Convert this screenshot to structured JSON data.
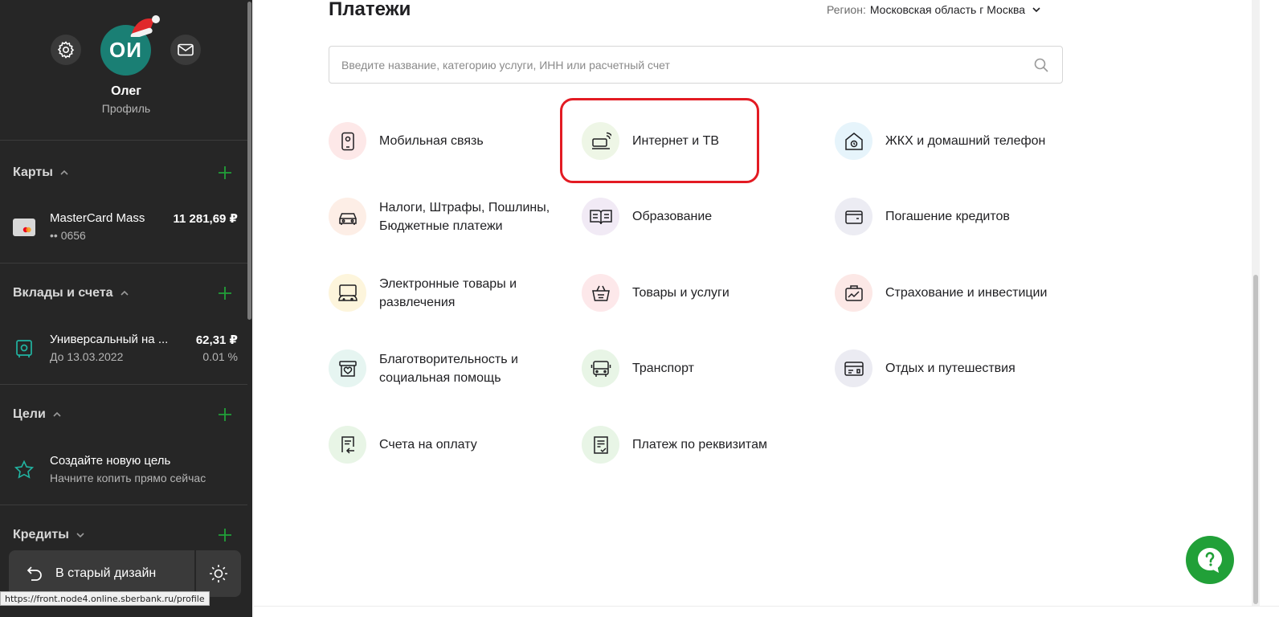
{
  "profile": {
    "initials": "ОИ",
    "name": "Олег",
    "subtitle": "Профиль"
  },
  "sidebar": {
    "cards": {
      "title": "Карты",
      "items": [
        {
          "name": "MasterCard Mass",
          "sub": "•• 0656",
          "amount": "11 281,69 ₽"
        }
      ]
    },
    "deposits": {
      "title": "Вклады и счета",
      "items": [
        {
          "name": "Универсальный на ...",
          "sub": "До 13.03.2022",
          "amount": "62,31 ₽",
          "amount_sub": "0.01 %"
        }
      ]
    },
    "goals": {
      "title": "Цели",
      "items": [
        {
          "name": "Создайте новую цель",
          "sub": "Начните копить прямо сейчас"
        }
      ]
    },
    "credits": {
      "title": "Кредиты"
    },
    "old_design_label": "В старый дизайн"
  },
  "status_url": "https://front.node4.online.sberbank.ru/profile",
  "main": {
    "title": "Платежи",
    "region_label": "Регион:",
    "region_value": "Московская область г Москва",
    "search_placeholder": "Введите название, категорию услуги, ИНН или расчетный счет",
    "categories": [
      {
        "label": "Мобильная связь",
        "icon": "mobile-icon",
        "color": "#fde8e8"
      },
      {
        "label": "Интернет и ТВ",
        "icon": "router-icon",
        "color": "#eef6e6"
      },
      {
        "label": "ЖКХ и домашний телефон",
        "icon": "house-icon",
        "color": "#e6f4fb"
      },
      {
        "label": "Налоги, Штрафы, Пошлины,\nБюджетные платежи",
        "icon": "car-icon",
        "color": "#fdeee6"
      },
      {
        "label": "Образование",
        "icon": "book-icon",
        "color": "#f1eaf5"
      },
      {
        "label": "Погашение кредитов",
        "icon": "wallet-icon",
        "color": "#ececf3"
      },
      {
        "label": "Электронные товары и\nразвлечения",
        "icon": "gamepad-icon",
        "color": "#fdf5dc"
      },
      {
        "label": "Товары и услуги",
        "icon": "basket-icon",
        "color": "#fde8ea"
      },
      {
        "label": "Страхование и инвестиции",
        "icon": "briefcase-icon",
        "color": "#fce8e6"
      },
      {
        "label": "Благотворительность и\nсоциальная помощь",
        "icon": "charity-box-icon",
        "color": "#e6f5f1"
      },
      {
        "label": "Транспорт",
        "icon": "bus-icon",
        "color": "#e8f5e6"
      },
      {
        "label": "Отдых и путешествия",
        "icon": "ticket-icon",
        "color": "#ebebf2"
      },
      {
        "label": "Счета на оплату",
        "icon": "invoice-icon",
        "color": "#e8f5e6"
      },
      {
        "label": "Платеж по реквизитам",
        "icon": "document-check-icon",
        "color": "#e8f5e6"
      }
    ]
  },
  "colors": {
    "sidebar_bg": "#262626",
    "accent_green": "#21a038",
    "highlight_red": "#e31b23"
  }
}
